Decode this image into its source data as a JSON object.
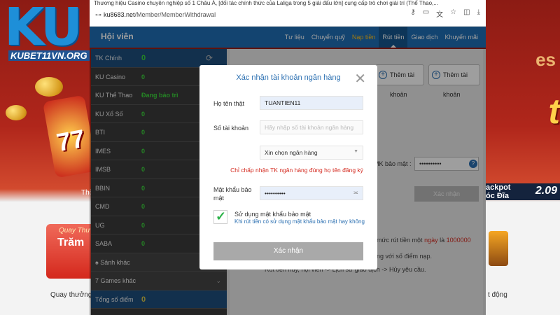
{
  "browser": {
    "tab_title": "Thương hiệu Casino chuyên nghiệp số 1 Châu Á, [đối tác chính thức của Laliga trong 5 giải đấu lớn] cung cấp trò chơi giải trí (Thể Thao,...",
    "url_host": "ku8683.net",
    "url_path": "/Member/MemberWithdrawal"
  },
  "logo": {
    "text": "KU",
    "site": "KUBET11VN.ORG"
  },
  "header": {
    "title": "Hội viên",
    "nav": [
      {
        "label": "Tư liệu"
      },
      {
        "label": "Chuyển quỹ"
      },
      {
        "label": "Nạp tiền"
      },
      {
        "label": "Rút tiền"
      },
      {
        "label": "Giao dịch"
      },
      {
        "label": "Khuyến mãi"
      }
    ]
  },
  "sidebar": {
    "rows": [
      {
        "label": "TK Chính",
        "value": "0"
      },
      {
        "label": "KU Casino",
        "value": "0"
      },
      {
        "label": "KU Thể Thao",
        "value": "Đang bảo trì"
      },
      {
        "label": "KU Xổ Số",
        "value": "0"
      },
      {
        "label": "BTI",
        "value": "0"
      },
      {
        "label": "IMES",
        "value": "0"
      },
      {
        "label": "IMSB",
        "value": "0"
      },
      {
        "label": "BBIN",
        "value": "0"
      },
      {
        "label": "CMD",
        "value": "0"
      },
      {
        "label": "UG",
        "value": "0"
      },
      {
        "label": "SABA",
        "value": "0"
      }
    ],
    "sections": [
      {
        "label": "♠ Sảnh khác"
      },
      {
        "label": "7 Games khác"
      }
    ],
    "total": {
      "label": "Tổng số điểm",
      "value": "0"
    }
  },
  "main": {
    "add_account_1": "Thêm tài khoản",
    "add_account_2": "Thêm tài khoản",
    "mk_label": "MK bảo mật :",
    "mk_value": "••••••••••",
    "xn_button": "Xác nhận",
    "notice1_a": "mức rút tiền một",
    "notice1_b": "ngày",
    "notice1_c": "là",
    "notice1_d": "1000000",
    "notice2_a": "ng",
    "notice2_b": "với số điểm nạp.",
    "notice3": "Rút tiền hủy, hội viên -> Lịch sử giao dịch -> Hủy yêu cầu."
  },
  "modal": {
    "title": "Xác nhận tài khoản ngân hàng",
    "name_label": "Họ tên thật",
    "name_value": "TUANTIEN11",
    "account_label": "Số tài khoản",
    "account_placeholder": "Hãy nhập số tài khoản ngân hàng",
    "bank_select": "Xin chọn ngân hàng",
    "warning": "Chỉ chấp nhận TK ngân hàng đúng họ tên đăng ký",
    "password_label_1": "Mật khẩu bảo",
    "password_label_2": "mật",
    "password_value": "••••••••••",
    "checkbox_label": "Sử dụng mật khẩu bảo mật",
    "checkbox_sub": "Khi rút tiền có sử dụng mật khẩu bảo mật hay không",
    "confirm": "Xác nhận"
  },
  "promo": {
    "banner_right_small": "es",
    "banner_right_big": "t",
    "strip_a": "ackpot",
    "strip_b": "óc Đĩa",
    "strip_value": "2.09",
    "card_t1": "Quay Thư",
    "card_t2": "Trăm",
    "left_banner_text": "Thờ",
    "bottom_left": "Quay thưởng t",
    "bottom_right": "t động"
  },
  "colors": {
    "brand": "#1f6fb5",
    "warning": "#d42a1f",
    "success": "#2db34a",
    "nav_active": "#ffc21e"
  }
}
